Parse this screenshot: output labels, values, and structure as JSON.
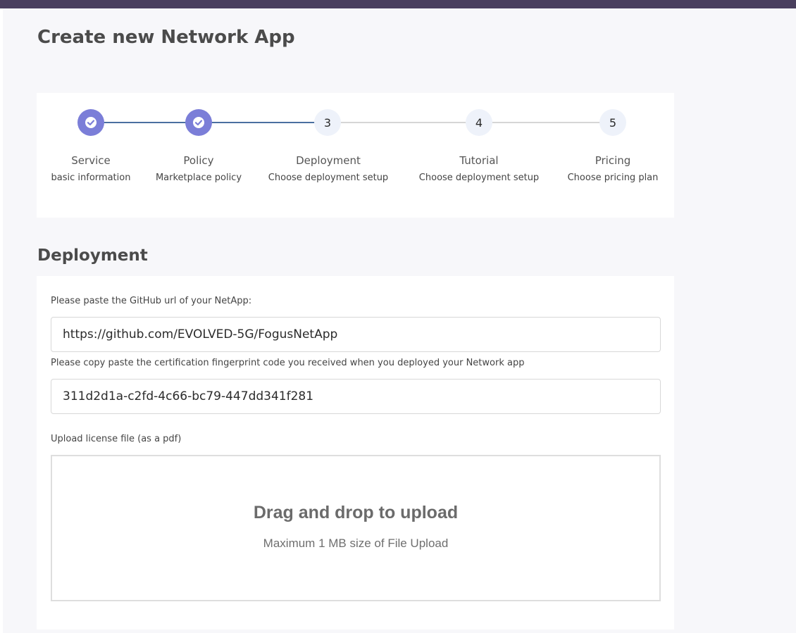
{
  "page": {
    "title": "Create new Network App"
  },
  "stepper": {
    "steps": [
      {
        "number": "1",
        "title": "Service",
        "subtitle": "basic information",
        "status": "completed"
      },
      {
        "number": "2",
        "title": "Policy",
        "subtitle": "Marketplace policy",
        "status": "completed"
      },
      {
        "number": "3",
        "title": "Deployment",
        "subtitle": "Choose deployment setup",
        "status": "active"
      },
      {
        "number": "4",
        "title": "Tutorial",
        "subtitle": "Choose deployment setup",
        "status": "pending"
      },
      {
        "number": "5",
        "title": "Pricing",
        "subtitle": "Choose pricing plan",
        "status": "pending"
      }
    ],
    "completed_icon": "check-icon",
    "colors": {
      "completed": "#7b7ed8",
      "line_done": "#4a6fa0",
      "line_todo": "#d6d6d6"
    }
  },
  "deployment": {
    "section_title": "Deployment",
    "github_label": "Please paste the GitHub url of your NetApp:",
    "github_value": "https://github.com/EVOLVED-5G/FogusNetApp",
    "fingerprint_label": "Please copy paste the certification fingerprint code you received when you deployed your Network app",
    "fingerprint_value": "311d2d1a-c2fd-4c66-bc79-447dd341f281",
    "license_label": "Upload license file (as a pdf)",
    "dropzone": {
      "title": "Drag and drop to upload",
      "subtitle": "Maximum 1 MB size of File Upload"
    }
  },
  "theme": {
    "header_bar": "#4a3f5e",
    "page_bg": "#f7f7fa"
  }
}
